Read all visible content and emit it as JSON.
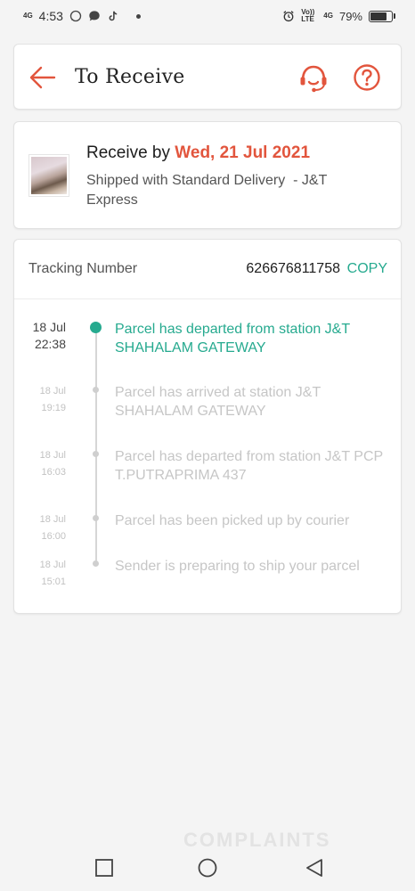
{
  "status_bar": {
    "network_left": "4G",
    "time": "4:53",
    "network_right": "4G",
    "volte": "Vo)) LTE",
    "battery": "79%",
    "battery_level": 0.79
  },
  "header": {
    "title": "To Receive"
  },
  "delivery": {
    "receive_label": "Receive by ",
    "receive_date": "Wed, 21 Jul 2021",
    "shipping_text": "Shipped with Standard Delivery  - J&T Express"
  },
  "tracking": {
    "label": "Tracking Number",
    "number": "626676811758",
    "copy_label": "COPY",
    "events": [
      {
        "date": "18 Jul",
        "time": "22:38",
        "text": "Parcel has departed from station J&T SHAHALAM GATEWAY",
        "active": true
      },
      {
        "date": "18 Jul",
        "time": "19:19",
        "text": "Parcel has arrived at station J&T SHAHALAM GATEWAY",
        "active": false
      },
      {
        "date": "18 Jul",
        "time": "16:03",
        "text": "Parcel has departed from station J&T PCP T.PUTRAPRIMA 437",
        "active": false
      },
      {
        "date": "18 Jul",
        "time": "16:00",
        "text": "Parcel has been picked up by courier",
        "active": false
      },
      {
        "date": "18 Jul",
        "time": "15:01",
        "text": "Sender is preparing to ship your parcel",
        "active": false
      }
    ]
  },
  "watermark": "COMPLAINTS",
  "colors": {
    "accent_orange": "#e2553d",
    "accent_green": "#26aa8f"
  },
  "icons": {
    "back": "arrow-left-icon",
    "support": "headset-icon",
    "help": "question-circle-icon",
    "nav_recent": "square-icon",
    "nav_home": "circle-icon",
    "nav_back": "triangle-icon"
  }
}
